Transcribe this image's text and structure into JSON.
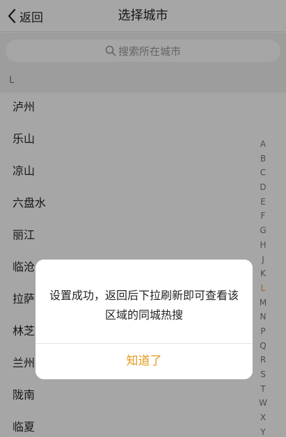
{
  "header": {
    "back_label": "返回",
    "title": "选择城市"
  },
  "search": {
    "placeholder": "搜索所在城市"
  },
  "section": {
    "letter": "L"
  },
  "cities": [
    "泸州",
    "乐山",
    "凉山",
    "六盘水",
    "丽江",
    "临沧",
    "拉萨",
    "林芝",
    "兰州",
    "陇南",
    "临夏"
  ],
  "index_letters": [
    "A",
    "B",
    "C",
    "D",
    "E",
    "F",
    "G",
    "H",
    "J",
    "K",
    "L",
    "M",
    "N",
    "P",
    "Q",
    "R",
    "S",
    "T",
    "W",
    "X",
    "Y"
  ],
  "active_index": "L",
  "dialog": {
    "message": "设置成功，返回后下拉刷新即可查看该区域的同城热搜",
    "confirm_label": "知道了"
  },
  "colors": {
    "accent": "#e39b1d",
    "overlay": "rgba(0,0,0,0.35)"
  }
}
